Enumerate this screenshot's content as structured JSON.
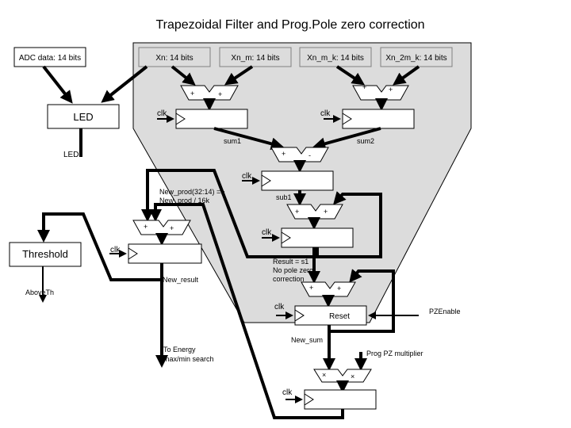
{
  "title": "Trapezoidal Filter and Prog.Pole zero correction",
  "inputs": {
    "adc": "ADC data: 14 bits",
    "xn": "Xn: 14 bits",
    "xn_m": "Xn_m: 14 bits",
    "xn_m_k": "Xn_m_k: 14 bits",
    "xn_2m_k": "Xn_2m_k: 14 bits"
  },
  "blocks": {
    "led": "LED",
    "threshold": "Threshold",
    "reset": "Reset"
  },
  "signals": {
    "led_out": "LED",
    "sum1": "sum1",
    "sum2": "sum2",
    "sub1": "sub1",
    "clk": "clk",
    "new_prod_1": "New_prod(32:14) =>",
    "new_prod_2": "New_prod / 16k",
    "new_result": "New_result",
    "above_th": "AboveTh",
    "result_1": "Result = s1",
    "result_2": "No pole zero",
    "result_3": "correction",
    "pz_enable": "PZEnable",
    "new_sum": "New_sum",
    "prog_pz": "Prog PZ multiplier",
    "to_energy_1": "To Energy",
    "to_energy_2": "max/min search"
  },
  "ops": {
    "plus": "+",
    "minus": "-",
    "times": "×"
  }
}
